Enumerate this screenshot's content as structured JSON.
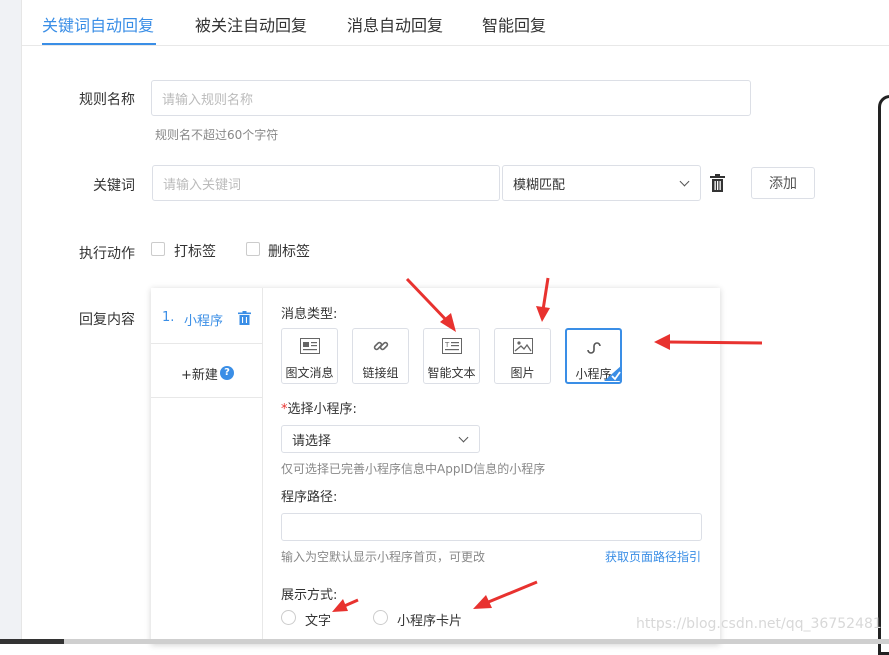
{
  "tabs": [
    {
      "label": "关键词自动回复",
      "active": true
    },
    {
      "label": "被关注自动回复",
      "active": false
    },
    {
      "label": "消息自动回复",
      "active": false
    },
    {
      "label": "智能回复",
      "active": false
    }
  ],
  "rule_name": {
    "label": "规则名称",
    "placeholder": "请输入规则名称",
    "hint": "规则名不超过60个字符"
  },
  "keyword": {
    "label": "关键词",
    "placeholder": "请输入关键词",
    "match_mode": "模糊匹配",
    "add_label": "添加"
  },
  "action": {
    "label": "执行动作",
    "options": [
      "打标签",
      "删标签"
    ]
  },
  "reply": {
    "label": "回复内容",
    "items": [
      {
        "index": "1.",
        "name": "小程序"
      }
    ],
    "new_label": "+新建",
    "msg_type_label": "消息类型:",
    "msg_types": [
      {
        "label": "图文消息",
        "icon": "news-icon",
        "selected": false
      },
      {
        "label": "链接组",
        "icon": "link-icon",
        "selected": false
      },
      {
        "label": "智能文本",
        "icon": "smart-text-icon",
        "selected": false
      },
      {
        "label": "图片",
        "icon": "image-icon",
        "selected": false
      },
      {
        "label": "小程序",
        "icon": "miniprogram-icon",
        "selected": true
      }
    ],
    "required_mark": "*",
    "select_mp_label": "选择小程序:",
    "select_mp_value": "请选择",
    "select_mp_hint": "仅可选择已完善小程序信息中AppID信息的小程序",
    "path_label": "程序路径:",
    "path_value": "",
    "path_hint": "输入为空默认显示小程序首页，可更改",
    "path_link": "获取页面路径指引",
    "display_label": "展示方式:",
    "display_options": [
      "文字",
      "小程序卡片"
    ]
  },
  "watermark": "https://blog.csdn.net/qq_36752481",
  "colors": {
    "accent": "#3a8ee6",
    "arrow": "#e8322f"
  }
}
